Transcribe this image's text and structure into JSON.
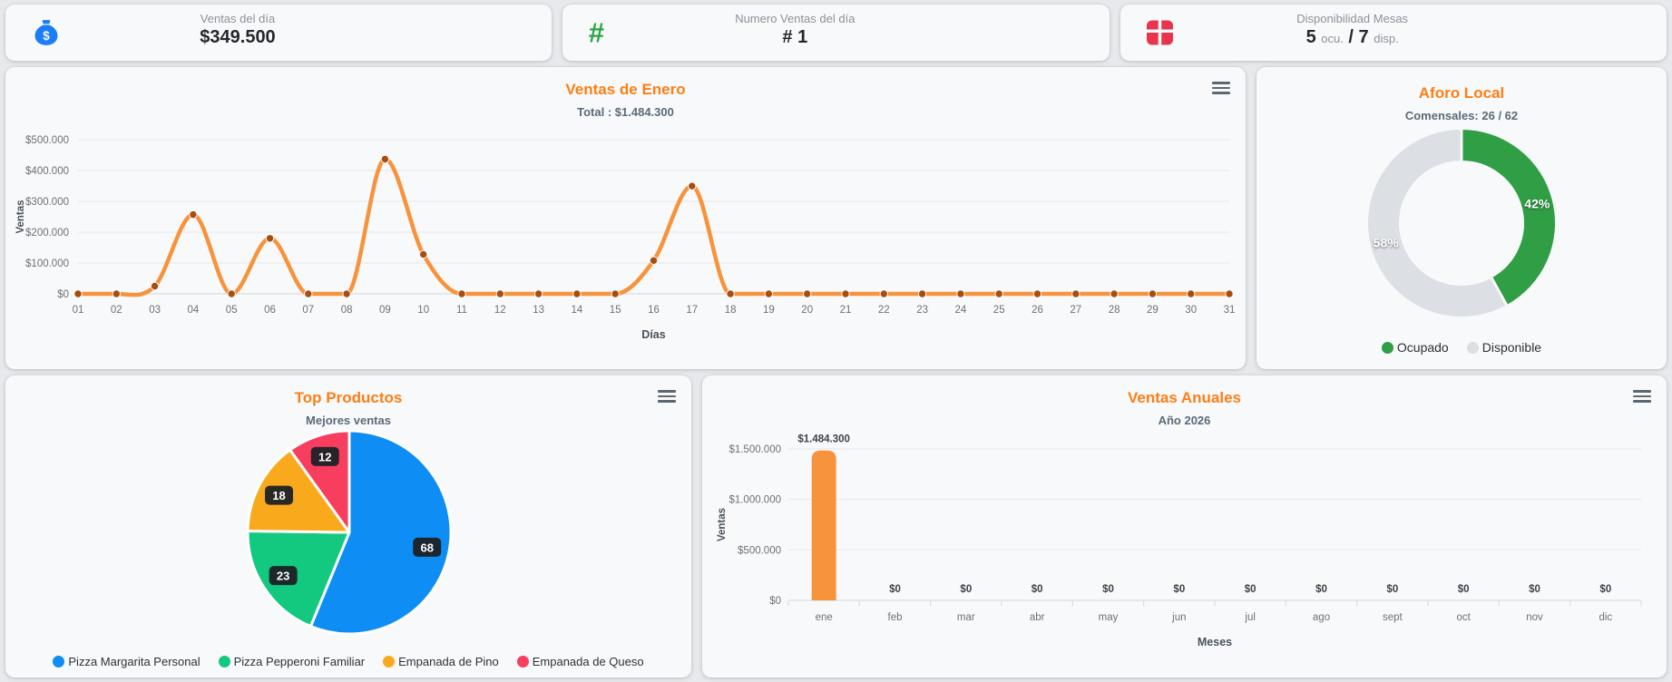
{
  "stat_cards": [
    {
      "icon": "money-bag-icon",
      "icon_color": "#1b7ef7",
      "label": "Ventas del día",
      "value": "$349.500"
    },
    {
      "icon": "hash-icon",
      "icon_color": "#28a745",
      "label": "Numero Ventas del día",
      "value": "# 1"
    },
    {
      "icon": "tables-grid-icon",
      "icon_color": "#e8354d",
      "label": "Disponibilidad Mesas",
      "occupied": "5",
      "occupied_unit": "ocu.",
      "separator": "/",
      "available": "7",
      "available_unit": "disp."
    }
  ],
  "menu_icon": "hamburger-menu-icon",
  "theme": {
    "title_color": "#fd7e14",
    "card_bg": "#f8f9fa",
    "page_bg": "#e7e9ec"
  },
  "chart_data": [
    {
      "id": "ventas_enero",
      "type": "line",
      "title": "Ventas de Enero",
      "subtitle": "Total : $1.484.300",
      "xlabel": "Días",
      "ylabel": "Ventas",
      "categories": [
        "01",
        "02",
        "03",
        "04",
        "05",
        "06",
        "07",
        "08",
        "09",
        "10",
        "11",
        "12",
        "13",
        "14",
        "15",
        "16",
        "17",
        "18",
        "19",
        "20",
        "21",
        "22",
        "23",
        "24",
        "25",
        "26",
        "27",
        "28",
        "29",
        "30",
        "31"
      ],
      "values": [
        0,
        0,
        25000,
        257000,
        0,
        180000,
        0,
        0,
        436800,
        128000,
        0,
        0,
        0,
        0,
        0,
        108000,
        349500,
        0,
        0,
        0,
        0,
        0,
        0,
        0,
        0,
        0,
        0,
        0,
        0,
        0,
        0
      ],
      "ylim": [
        0,
        500000
      ],
      "ytick_step": 100000,
      "ytick_labels": [
        "$0",
        "$100.000",
        "$200.000",
        "$300.000",
        "$400.000",
        "$500.000"
      ],
      "grid": true,
      "line_color": "#f7933c",
      "point_color": "#a84d10"
    },
    {
      "id": "aforo_local",
      "type": "pie",
      "variant": "donut",
      "title": "Aforo Local",
      "subtitle": "Comensales: 26 / 62",
      "slices": [
        {
          "label": "Ocupado",
          "pct": 42,
          "pct_label": "42%",
          "color": "#2f9e44"
        },
        {
          "label": "Disponible",
          "pct": 58,
          "pct_label": "58%",
          "color": "#dcdfe3"
        }
      ],
      "legend_position": "bottom"
    },
    {
      "id": "top_productos",
      "type": "pie",
      "title": "Top Productos",
      "subtitle": "Mejores ventas",
      "slices": [
        {
          "label": "Pizza Margarita Personal",
          "value": 68,
          "value_label": "68",
          "color": "#0e8df5"
        },
        {
          "label": "Pizza Pepperoni Familiar",
          "value": 23,
          "value_label": "23",
          "color": "#12c97f"
        },
        {
          "label": "Empanada de Pino",
          "value": 18,
          "value_label": "18",
          "color": "#f9a91c"
        },
        {
          "label": "Empanada de Queso",
          "value": 12,
          "value_label": "12",
          "color": "#f83e5e"
        }
      ],
      "legend_position": "bottom"
    },
    {
      "id": "ventas_anuales",
      "type": "bar",
      "title": "Ventas Anuales",
      "subtitle": "Año 2026",
      "xlabel": "Meses",
      "ylabel": "Ventas",
      "categories": [
        "ene",
        "feb",
        "mar",
        "abr",
        "may",
        "jun",
        "jul",
        "ago",
        "sept",
        "oct",
        "nov",
        "dic"
      ],
      "values": [
        1484300,
        0,
        0,
        0,
        0,
        0,
        0,
        0,
        0,
        0,
        0,
        0
      ],
      "bar_labels": [
        "$1.484.300",
        "$0",
        "$0",
        "$0",
        "$0",
        "$0",
        "$0",
        "$0",
        "$0",
        "$0",
        "$0",
        "$0"
      ],
      "ylim": [
        0,
        1500000
      ],
      "ytick_step": 500000,
      "ytick_labels": [
        "$0",
        "$500.000",
        "$1.000.000",
        "$1.500.000"
      ],
      "grid": true,
      "bar_color": "#f7933c"
    }
  ]
}
